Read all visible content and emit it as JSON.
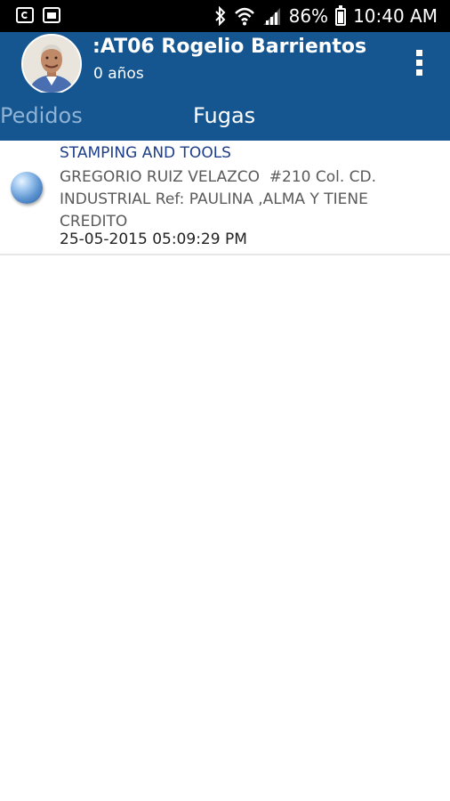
{
  "status_bar": {
    "left_icons": [
      "sync-icon",
      "image-icon"
    ],
    "right_icons": [
      "bluetooth-icon",
      "wifi-icon",
      "signal-icon",
      "battery-icon"
    ],
    "battery": "86%",
    "time": "10:40 AM"
  },
  "header": {
    "user_name": ":AT06 Rogelio Barrientos",
    "age": "0 años",
    "menu_icon": "overflow-menu-icon"
  },
  "tabs": [
    {
      "label": "Pedidos",
      "active": false
    },
    {
      "label": "Fugas",
      "active": true
    }
  ],
  "list": [
    {
      "title": "STAMPING AND TOOLS",
      "address": "GREGORIO RUIZ VELAZCO  #210 Col. CD. INDUSTRIAL Ref: PAULINA ,ALMA Y TIENE CREDITO",
      "date": "25-05-2015 05:09:29 PM",
      "icon": "blue-sphere-icon"
    }
  ],
  "colors": {
    "header_bg": "#155690",
    "status_bar_bg": "#000000",
    "title_text": "#1d3e8a",
    "inactive_tab": "#8fb3d4"
  }
}
